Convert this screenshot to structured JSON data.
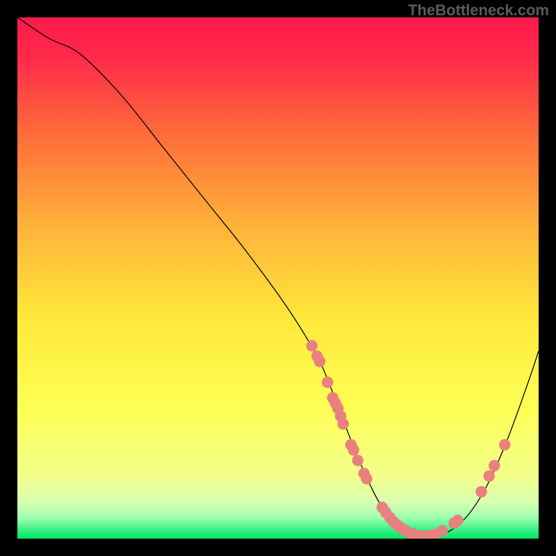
{
  "watermark": "TheBottleneck.com",
  "chart_data": {
    "type": "line",
    "title": "",
    "xlabel": "",
    "ylabel": "",
    "xlim": [
      0,
      100
    ],
    "ylim": [
      0,
      100
    ],
    "grid": false,
    "legend": false,
    "background_gradient": {
      "top": "#ff1a4a",
      "upper_mid": "#ff8a2a",
      "mid": "#ffe93a",
      "lower_mid": "#f7ff70",
      "bottom": "#00e860"
    },
    "series": [
      {
        "name": "bottleneck-curve",
        "color": "#000000",
        "x": [
          0,
          6,
          12,
          20,
          28,
          36,
          44,
          52,
          58,
          62,
          66,
          70,
          74,
          78,
          82,
          86,
          90,
          94,
          98,
          100
        ],
        "y": [
          100,
          96,
          93,
          85,
          75,
          65,
          55,
          44,
          34,
          24,
          14,
          6,
          2,
          0.5,
          1,
          4,
          10,
          19,
          30,
          36
        ]
      }
    ],
    "markers": {
      "name": "highlight-points",
      "color": "#e98080",
      "radius": 1.1,
      "points": [
        {
          "x": 56.5,
          "y": 37
        },
        {
          "x": 57.5,
          "y": 35
        },
        {
          "x": 58.0,
          "y": 34
        },
        {
          "x": 59.5,
          "y": 30
        },
        {
          "x": 60.5,
          "y": 27
        },
        {
          "x": 61.0,
          "y": 26
        },
        {
          "x": 61.5,
          "y": 25
        },
        {
          "x": 62.0,
          "y": 23.5
        },
        {
          "x": 62.5,
          "y": 22
        },
        {
          "x": 64.0,
          "y": 18
        },
        {
          "x": 64.5,
          "y": 17
        },
        {
          "x": 65.3,
          "y": 15
        },
        {
          "x": 66.5,
          "y": 12.5
        },
        {
          "x": 67.0,
          "y": 11.5
        },
        {
          "x": 70.0,
          "y": 6
        },
        {
          "x": 70.7,
          "y": 5
        },
        {
          "x": 71.5,
          "y": 4
        },
        {
          "x": 72.2,
          "y": 3.2
        },
        {
          "x": 73.0,
          "y": 2.5
        },
        {
          "x": 73.7,
          "y": 2
        },
        {
          "x": 74.5,
          "y": 1.5
        },
        {
          "x": 75.5,
          "y": 1
        },
        {
          "x": 76.2,
          "y": 0.8
        },
        {
          "x": 77.0,
          "y": 0.5
        },
        {
          "x": 78.0,
          "y": 0.5
        },
        {
          "x": 79.2,
          "y": 0.6
        },
        {
          "x": 80.0,
          "y": 0.8
        },
        {
          "x": 81.5,
          "y": 1.5
        },
        {
          "x": 83.8,
          "y": 3
        },
        {
          "x": 84.5,
          "y": 3.5
        },
        {
          "x": 89.0,
          "y": 9
        },
        {
          "x": 90.5,
          "y": 12
        },
        {
          "x": 91.5,
          "y": 14
        },
        {
          "x": 93.5,
          "y": 18
        }
      ]
    }
  }
}
